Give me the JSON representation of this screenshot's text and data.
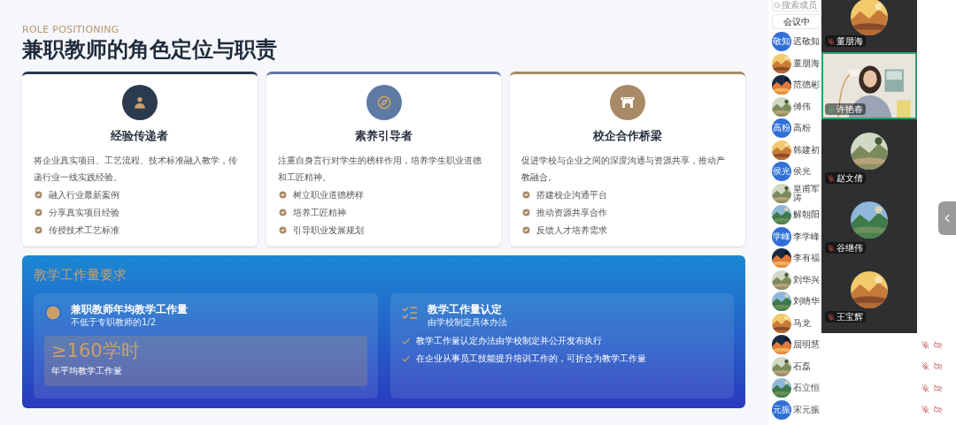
{
  "slide": {
    "eyebrow": "ROLE POSITIONING",
    "title": "兼职教师的角色定位与职责",
    "cards": [
      {
        "kind": "person",
        "color": "#2b3a4d",
        "title": "经验传递者",
        "description": "将企业真实项目、工艺流程、技术标准融入教学，传递行业一线实践经验。",
        "points": [
          "融入行业最新案例",
          "分享真实项目经验",
          "传授技术工艺标准"
        ]
      },
      {
        "kind": "compass",
        "color": "#5d7aa5",
        "title": "素养引导者",
        "description": "注重自身言行对学生的榜样作用，培养学生职业道德和工匠精神。",
        "points": [
          "树立职业道德榜样",
          "培养工匠精神",
          "引导职业发展规划"
        ]
      },
      {
        "kind": "bridge",
        "color": "#a88a67",
        "title": "校企合作桥梁",
        "description": "促进学校与企业之间的深度沟通与资源共享，推动产教融合。",
        "points": [
          "搭建校企沟通平台",
          "推动资源共享合作",
          "反馈人才培养需求"
        ]
      }
    ],
    "workload": {
      "heading": "教学工作量要求",
      "panels": [
        {
          "kind": "stat",
          "title": "兼职教师年均教学工作量",
          "subtitle": "不低于专职教师的1/2",
          "value": "≥160学时",
          "caption": "年平均教学工作量"
        },
        {
          "kind": "list",
          "title": "教学工作量认定",
          "subtitle": "由学校制定具体办法",
          "items": [
            "教学工作量认定办法由学校制定并公开发布执行",
            "在企业从事员工技能提升培训工作的，可折合为教学工作量"
          ]
        }
      ]
    }
  },
  "sidebar": {
    "search": {
      "placeholder": "搜索成员"
    },
    "tab": "会议中",
    "participants": [
      {
        "name": "迟敬知",
        "avatar": {
          "kind": "text",
          "label": "敬知"
        },
        "muted": false
      },
      {
        "name": "董朋海",
        "muted": false
      },
      {
        "name": "范德彬",
        "muted": false
      },
      {
        "name": "傅伟",
        "muted": false
      },
      {
        "name": "高粉",
        "avatar": {
          "kind": "text",
          "label": "高粉"
        },
        "muted": false
      },
      {
        "name": "韩建初",
        "muted": false
      },
      {
        "name": "侯光",
        "avatar": {
          "kind": "text",
          "label": "侯光"
        },
        "muted": false
      },
      {
        "name": "皇甫军涛",
        "muted": false
      },
      {
        "name": "解朝阳",
        "muted": false
      },
      {
        "name": "李学峰",
        "avatar": {
          "kind": "text",
          "label": "学峰"
        },
        "muted": false
      },
      {
        "name": "李有福",
        "muted": false
      },
      {
        "name": "刘华兴",
        "muted": false
      },
      {
        "name": "刘晴华",
        "muted": false
      },
      {
        "name": "马龙",
        "muted": false
      },
      {
        "name": "屈明慧",
        "muted": true
      },
      {
        "name": "石磊",
        "muted": true
      },
      {
        "name": "石立恒",
        "muted": true
      },
      {
        "name": "宋元振",
        "avatar": {
          "kind": "text",
          "label": "元振"
        },
        "muted": true
      }
    ]
  },
  "video_panel": {
    "tiles": [
      {
        "name": "董朋海",
        "kind": "avatar",
        "mic_on": false,
        "speaking": false
      },
      {
        "name": "许艳春",
        "kind": "video",
        "mic_on": true,
        "speaking": true
      },
      {
        "name": "赵文倩",
        "kind": "avatar",
        "mic_on": false,
        "speaking": false
      },
      {
        "name": "谷继伟",
        "kind": "avatar",
        "mic_on": false,
        "speaking": false
      },
      {
        "name": "王宝辉",
        "kind": "avatar",
        "mic_on": false,
        "speaking": false
      }
    ]
  }
}
